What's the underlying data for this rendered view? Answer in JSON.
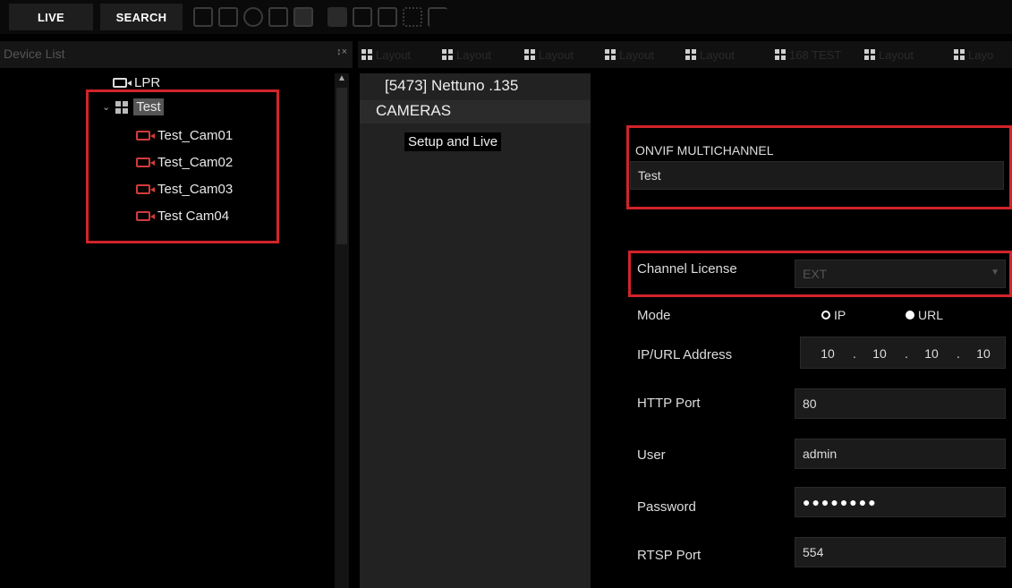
{
  "toolbar": {
    "live_label": "LIVE",
    "search_label": "SEARCH",
    "icons": [
      "camera-layout-icon",
      "export-icon",
      "check-icon",
      "square-icon",
      "filled-square-icon",
      "record-icon",
      "user-gear-icon",
      "person-icon",
      "dots-icon",
      "curve-icon"
    ]
  },
  "device_list": {
    "header": "Device List",
    "pin_close": "↕×",
    "items": [
      {
        "label": "LPR",
        "icon": "camera-icon"
      },
      {
        "label": "Test",
        "icon": "group-icon",
        "expanded": true,
        "selected": true
      },
      {
        "label": "Test_Cam01",
        "icon": "camera-icon"
      },
      {
        "label": "Test_Cam02",
        "icon": "camera-icon"
      },
      {
        "label": "Test_Cam03",
        "icon": "camera-icon"
      },
      {
        "label": "Test Cam04",
        "icon": "camera-icon"
      }
    ]
  },
  "tabs": [
    {
      "label": "Layout"
    },
    {
      "label": "Layout"
    },
    {
      "label": "Layout"
    },
    {
      "label": "Layout"
    },
    {
      "label": "Layout"
    },
    {
      "label": "168 TEST"
    },
    {
      "label": "Layout"
    },
    {
      "label": "Layo"
    }
  ],
  "server_panel": {
    "title": "[5473] Nettuno .135",
    "category": "CAMERAS",
    "item": "Setup and Live"
  },
  "form": {
    "group_title": "ONVIF MULTICHANNEL",
    "group_name": "Test",
    "channel_license_label": "Channel License",
    "channel_license_value": "EXT",
    "mode_label": "Mode",
    "mode_options": [
      "IP",
      "URL"
    ],
    "mode_selected": "URL",
    "ip_label": "IP/URL Address",
    "ip_octets": [
      "10",
      "10",
      "10",
      "10"
    ],
    "http_port_label": "HTTP Port",
    "http_port": "80",
    "user_label": "User",
    "user": "admin",
    "password_label": "Password",
    "password_mask": "●●●●●●●●",
    "rtsp_port_label": "RTSP Port",
    "rtsp_port": "554"
  },
  "colors": {
    "highlight": "#d2232a",
    "camera_icon": "#d23b3b",
    "background": "#000000"
  }
}
